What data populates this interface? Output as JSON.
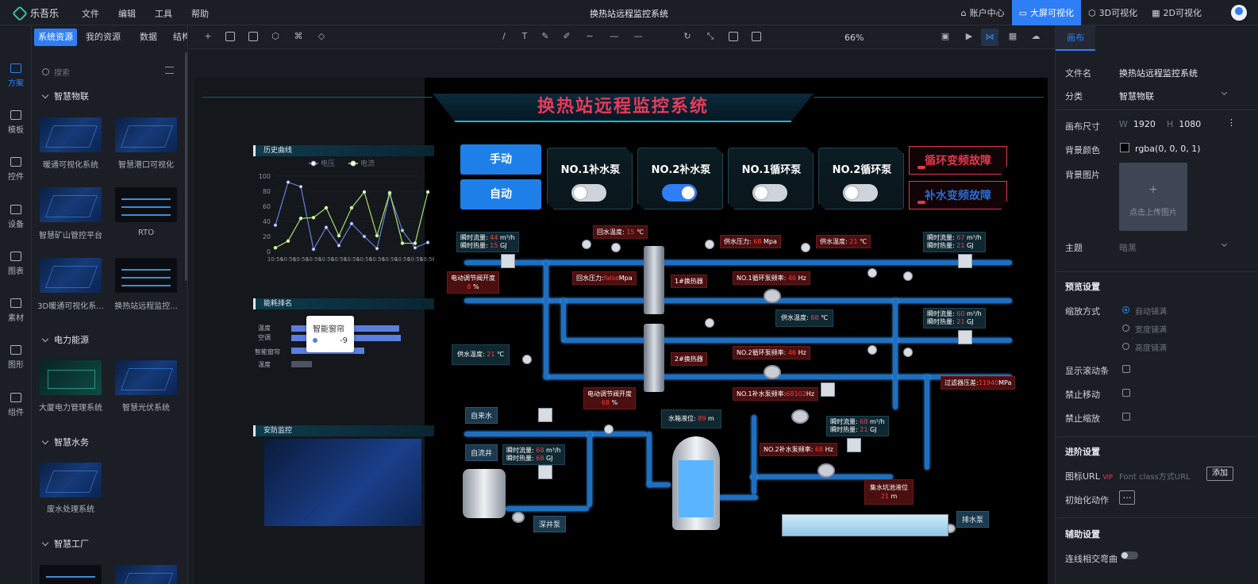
{
  "app": {
    "name": "乐吾乐",
    "doc_title": "换热站远程监控系统"
  },
  "menu": [
    "文件",
    "编辑",
    "工具",
    "帮助"
  ],
  "topright": {
    "account": "账户中心",
    "bigscreen": "大屏可视化",
    "viz3d": "3D可视化",
    "viz2d": "2D可视化"
  },
  "rail": [
    "方案",
    "模板",
    "控件",
    "设备",
    "图表",
    "素材",
    "图形",
    "组件"
  ],
  "left_tabs": [
    "系统资源",
    "我的资源",
    "数据",
    "结构"
  ],
  "search_placeholder": "搜索",
  "categories": [
    {
      "name": "智慧物联",
      "items": [
        "暖通可视化系统",
        "智慧港口可视化",
        "智慧矿山管控平台",
        "RTO",
        "3D暖通可视化系...",
        "换热站远程监控..."
      ]
    },
    {
      "name": "电力能源",
      "items": [
        "大厦电力管理系统",
        "智慧光伏系统"
      ]
    },
    {
      "name": "智慧水务",
      "items": [
        "废水处理系统"
      ]
    },
    {
      "name": "智慧工厂",
      "items": []
    }
  ],
  "toolbar": {
    "zoom": "66%"
  },
  "scada": {
    "title": "换热站远程监控系统",
    "panels": {
      "history": "历史曲线",
      "energy": "能耗排名",
      "security": "安防监控"
    },
    "legend": [
      "电压",
      "电流"
    ],
    "btn_manual": "手动",
    "btn_auto": "自动",
    "pumps": [
      {
        "label": "NO.1补水泵",
        "on": false
      },
      {
        "label": "NO.2补水泵",
        "on": true
      },
      {
        "label": "NO.1循环泵",
        "on": false
      },
      {
        "label": "NO.2循环泵",
        "on": false
      }
    ],
    "faults": [
      "循环变频故障",
      "补水变频故障"
    ],
    "tooltip": {
      "name": "智能窗帘",
      "value": "-9"
    },
    "energy_labels": [
      "温度",
      "空调",
      "智能窗帘",
      "温度"
    ],
    "readings": {
      "flow1a": "瞬时流量:",
      "flow1a_v": "44",
      "flow1a_u": "m³/h",
      "flow1b": "瞬时热量:",
      "flow1b_v": "15",
      "flow1b_u": "GJ",
      "return_temp": "回水温度:",
      "return_temp_v": "15",
      "return_temp_u": "℃",
      "supply_press": "供水压力:",
      "supply_press_v": "68",
      "supply_press_u": "Mpa",
      "supply_temp1": "供水温度:",
      "supply_temp1_v": "21",
      "supply_temp1_u": "℃",
      "flow2a": "瞬时流量:",
      "flow2a_v": "67",
      "flow2a_u": "m³/h",
      "flow2b": "瞬时热量:",
      "flow2b_v": "21",
      "flow2b_u": "GJ",
      "valve1": "电动调节阀开度",
      "valve1_v": "8",
      "valve1_u": "%",
      "return_press": "回水压力:",
      "return_press_v": "false",
      "return_press_u": "Mpa",
      "hx1": "1#换热器",
      "circ1": "NO.1循环泵频率:",
      "circ1_v": "46",
      "circ1_u": "Hz",
      "supply_temp2": "供水温度:",
      "supply_temp2_v": "88",
      "supply_temp2_u": "℃",
      "flow3a": "瞬时流量:",
      "flow3a_v": "60",
      "flow3a_u": "m³/h",
      "flow3b": "瞬时热量:",
      "flow3b_v": "21",
      "flow3b_u": "GJ",
      "supply_temp3": "供水温度:",
      "supply_temp3_v": "21",
      "supply_temp3_u": "℃",
      "hx2": "2#换热器",
      "circ2": "NO.2循环泵频率:",
      "circ2_v": "46",
      "circ2_u": "Hz",
      "valve2": "电动调节阀开度",
      "valve2_v": "68",
      "valve2_u": "%",
      "make1": "NO.1补水泵频率:",
      "make1_v": "68102",
      "make1_u": "Hz",
      "filter": "过滤器压差:",
      "filter_v": "11940",
      "filter_u": "MPa",
      "tank_level": "水箱液位:",
      "tank_level_v": "89",
      "tank_level_u": "m",
      "flow4a": "瞬时流量:",
      "flow4a_v": "68",
      "flow4a_u": "m³/h",
      "flow4b": "瞬时热量:",
      "flow4b_v": "21",
      "flow4b_u": "GJ",
      "make2": "NO.2补水泵频率:",
      "make2_v": "68",
      "make2_u": "Hz",
      "flow5a": "瞬时流量:",
      "flow5a_v": "68",
      "flow5a_u": "m³/h",
      "flow5b": "瞬时热量:",
      "flow5b_v": "68",
      "flow5b_u": "GJ",
      "pit": "集水坑池液位",
      "pit_v": "21",
      "pit_u": "m"
    },
    "tags": {
      "tap": "自来水",
      "well": "自流井",
      "deep": "深井泵",
      "drain": "排水泵"
    }
  },
  "chart_data": {
    "type": "line",
    "title": "历史曲线",
    "x": [
      "10:56",
      "10:56",
      "10:56",
      "10:56",
      "10:56",
      "10:56",
      "10:56",
      "10:56",
      "10:56",
      "10:56",
      "10:56",
      "10:56",
      "10:56"
    ],
    "series": [
      {
        "name": "电压",
        "values": [
          35,
          92,
          86,
          3,
          32,
          8,
          37,
          20,
          4,
          76,
          28,
          5,
          12
        ]
      },
      {
        "name": "电流",
        "values": [
          5,
          14,
          44,
          45,
          58,
          21,
          58,
          79,
          21,
          78,
          11,
          11,
          79
        ]
      }
    ],
    "ylim": [
      0,
      100
    ],
    "yticks": [
      0,
      20,
      40,
      60,
      80,
      100
    ],
    "colors": [
      "#6a7fd9",
      "#a6e06a"
    ]
  },
  "right": {
    "tab": "画布",
    "filename_label": "文件名",
    "filename": "换热站远程监控系统",
    "category_label": "分类",
    "category": "智慧物联",
    "size_label": "画布尺寸",
    "w_label": "W",
    "w": "1920",
    "h_label": "H",
    "h": "1080",
    "bg_color_label": "背景颜色",
    "bg_color": "rgba(0, 0, 0, 1)",
    "bg_img_label": "背景图片",
    "upload_hint": "点击上传图片",
    "theme_label": "主题",
    "theme": "暗黑",
    "preview_title": "预览设置",
    "scale_label": "缩放方式",
    "scale_opts": [
      "自动铺满",
      "宽度铺满",
      "高度铺满"
    ],
    "scrollbar_label": "显示滚动条",
    "nomove_label": "禁止移动",
    "nozoom_label": "禁止缩放",
    "adv_title": "进阶设置",
    "iconurl_label": "图标URL",
    "vip": "VIP",
    "iconurl_ph": "Font class方式URL",
    "add": "添加",
    "init_label": "初始化动作",
    "aux_title": "辅助设置",
    "cross_label": "连线相交弯曲"
  }
}
